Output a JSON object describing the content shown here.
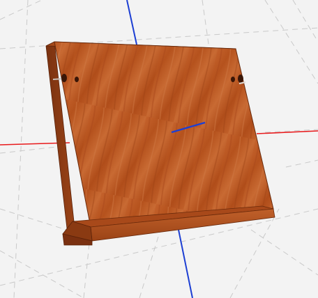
{
  "viewport": {
    "background": "#f3f3f3",
    "grid_color": "#c9c9c9"
  },
  "axes": {
    "x_color": "#e8191b",
    "y_color": "#1d3fd3",
    "z_color": "#1d3fd3"
  },
  "model": {
    "name": "wooden-board-stand",
    "wood_base": "#b8551f",
    "wood_light": "#c96a34",
    "wood_dark": "#8f3d13",
    "edge_color": "#6a2a0b",
    "hole_color": "#3a1607"
  },
  "icons": {
    "hinge_left": "pin-icon",
    "hinge_right": "pin-icon"
  }
}
